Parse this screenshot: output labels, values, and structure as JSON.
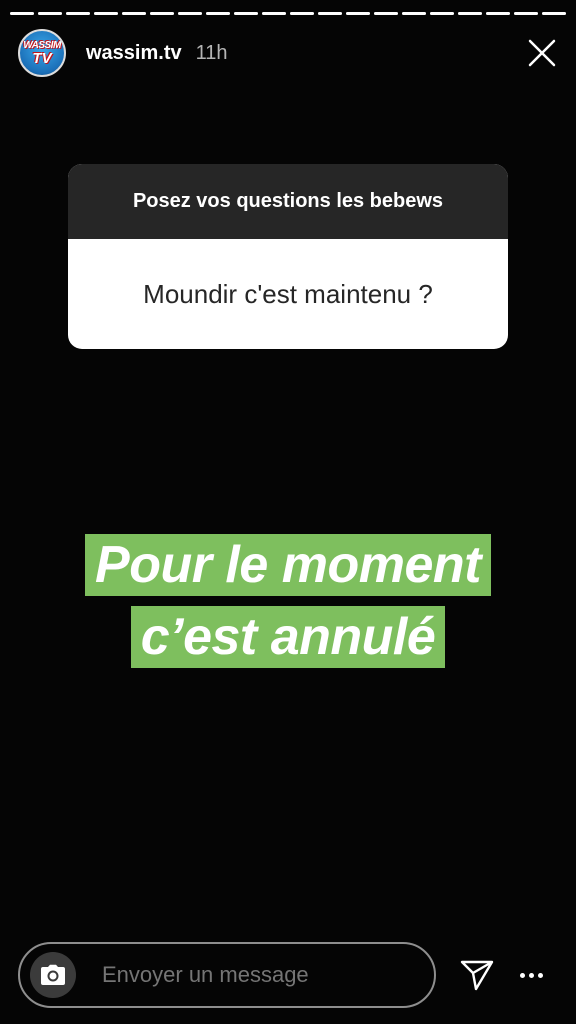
{
  "story": {
    "segments": 20,
    "active_segment": 19,
    "active_progress": 1.0
  },
  "header": {
    "avatar_text_line1": "WASSIM",
    "avatar_text_line2": "TV",
    "username": "wassim.tv",
    "time_ago": "11h",
    "close_icon": "close-icon"
  },
  "question_card": {
    "prompt": "Posez vos questions les bebews",
    "question": "Moundir c'est maintenu ?"
  },
  "answer": {
    "line1": "Pour le moment",
    "line2": "c’est annulé",
    "highlight_color": "#7ebf5e"
  },
  "footer": {
    "camera_icon": "camera-icon",
    "message_placeholder": "Envoyer un message",
    "send_icon": "send-icon",
    "more_icon": "more-icon"
  }
}
